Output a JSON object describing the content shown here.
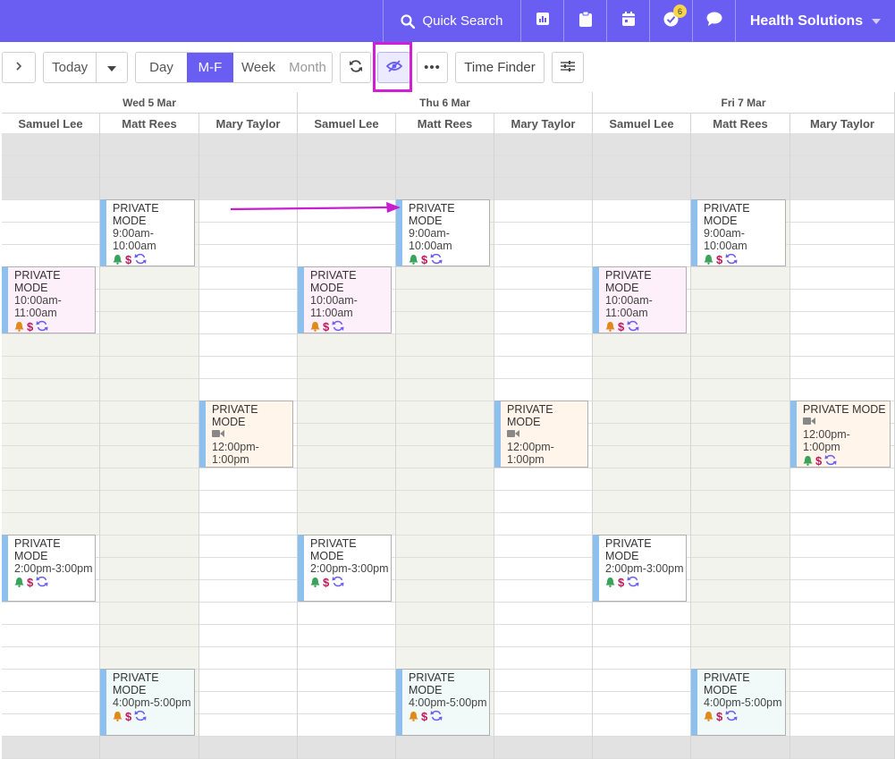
{
  "topbar": {
    "search_label": "Quick Search",
    "notif_count": "6",
    "org_name": "Health Solutions",
    "icons": [
      "search-icon",
      "chart-icon",
      "clipboard-icon",
      "calendar-icon",
      "check-circle-icon",
      "chat-icon"
    ]
  },
  "toolbar": {
    "today_label": "Today",
    "views": [
      "Day",
      "M-F",
      "Week",
      "Month"
    ],
    "active_view": "M-F",
    "time_finder_label": "Time Finder"
  },
  "calendar": {
    "days": [
      {
        "label": "Wed 5 Mar",
        "staff": [
          "Samuel Lee",
          "Matt Rees",
          "Mary Taylor"
        ]
      },
      {
        "label": "Thu 6 Mar",
        "staff": [
          "Samuel Lee",
          "Matt Rees",
          "Mary Taylor"
        ]
      },
      {
        "label": "Fri 7 Mar",
        "staff": [
          "Samuel Lee",
          "Matt Rees",
          "Mary Taylor"
        ]
      }
    ],
    "appt_title": "PRIVATE MODE",
    "appointments": [
      {
        "day": 0,
        "staff": 1,
        "time": "9:00am-10:00am"
      },
      {
        "day": 1,
        "staff": 1,
        "time": "9:00am-10:00am"
      },
      {
        "day": 2,
        "staff": 1,
        "time": "9:00am-10:00am"
      },
      {
        "day": 0,
        "staff": 0,
        "time": "10:00am-11:00am"
      },
      {
        "day": 1,
        "staff": 0,
        "time": "10:00am-11:00am"
      },
      {
        "day": 2,
        "staff": 0,
        "time": "10:00am-11:00am"
      },
      {
        "day": 0,
        "staff": 2,
        "time": "12:00pm-1:00pm",
        "video": true
      },
      {
        "day": 1,
        "staff": 2,
        "time": "12:00pm-1:00pm",
        "video": true
      },
      {
        "day": 2,
        "staff": 2,
        "time": "12:00pm-1:00pm",
        "video": true
      },
      {
        "day": 0,
        "staff": 0,
        "time": "2:00pm-3:00pm"
      },
      {
        "day": 1,
        "staff": 0,
        "time": "2:00pm-3:00pm"
      },
      {
        "day": 2,
        "staff": 0,
        "time": "2:00pm-3:00pm"
      },
      {
        "day": 0,
        "staff": 1,
        "time": "4:00pm-5:00pm"
      },
      {
        "day": 1,
        "staff": 1,
        "time": "4:00pm-5:00pm"
      },
      {
        "day": 2,
        "staff": 1,
        "time": "4:00pm-5:00pm"
      }
    ],
    "colors": {
      "accent": "#6a5df2",
      "highlight": "#d21fd6",
      "appt_9am": "#ffffff",
      "appt_10am": "#fdf0fb",
      "appt_12pm": "#fff5ea",
      "appt_2pm": "#ffffff",
      "appt_4pm": "#f1f9f9",
      "bell_green": "#3aa35a",
      "bell_orange": "#e08a1c",
      "recur_icon": "#6a5df2"
    }
  }
}
